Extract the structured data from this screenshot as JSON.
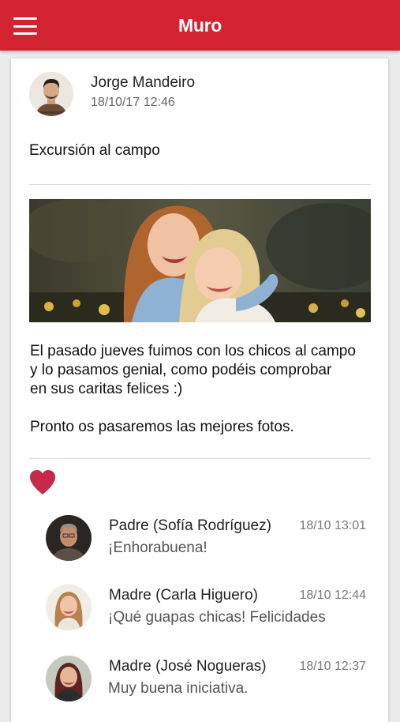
{
  "appbar": {
    "title": "Muro",
    "menu_icon": "hamburger-menu-icon"
  },
  "post": {
    "author": "Jorge Mandeiro",
    "date": "18/10/17 12:46",
    "title": "Excursión al campo",
    "body_line_1": "El pasado jueves fuimos con los chicos al campo",
    "body_line_2": "y lo pasamos genial, como podéis comprobar",
    "body_line_3": "en sus caritas felices :)",
    "body_line_4": "Pronto os pasaremos las mejores fotos.",
    "like_icon": "heart-icon",
    "like_color": "#c42a4a"
  },
  "comments": [
    {
      "author": "Padre (Sofía Rodríguez)",
      "time": "18/10 13:01",
      "text": "¡Enhorabuena!"
    },
    {
      "author": "Madre (Carla Higuero)",
      "time": "18/10 12:44",
      "text": "¡Qué guapas chicas! Felicidades"
    },
    {
      "author": "Madre (José Nogueras)",
      "time": "18/10 12:37",
      "text": "Muy buena iniciativa."
    }
  ],
  "colors": {
    "accent": "#d32330",
    "background": "#ececec"
  }
}
